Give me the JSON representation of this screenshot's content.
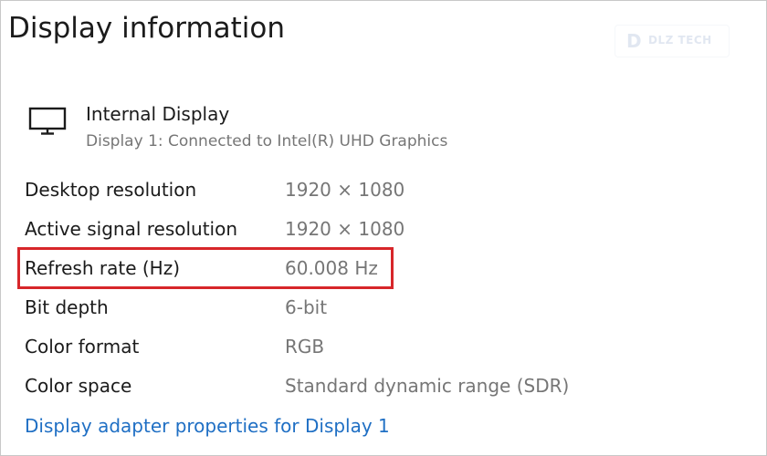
{
  "page": {
    "title": "Display information"
  },
  "watermark": {
    "mark": "D",
    "text": "DLZ TECH"
  },
  "display": {
    "icon": "monitor-icon",
    "name": "Internal Display",
    "subtitle": "Display 1: Connected to Intel(R) UHD Graphics"
  },
  "rows": [
    {
      "label": "Desktop resolution",
      "value": "1920 × 1080"
    },
    {
      "label": "Active signal resolution",
      "value": "1920 × 1080"
    },
    {
      "label": "Refresh rate (Hz)",
      "value": "60.008 Hz"
    },
    {
      "label": "Bit depth",
      "value": "6-bit"
    },
    {
      "label": "Color format",
      "value": "RGB"
    },
    {
      "label": "Color space",
      "value": "Standard dynamic range (SDR)"
    }
  ],
  "links": {
    "adapter_properties": "Display adapter properties for Display 1"
  },
  "colors": {
    "highlight": "#d7262a",
    "link": "#1f6fc4",
    "secondary_text": "#767676"
  }
}
